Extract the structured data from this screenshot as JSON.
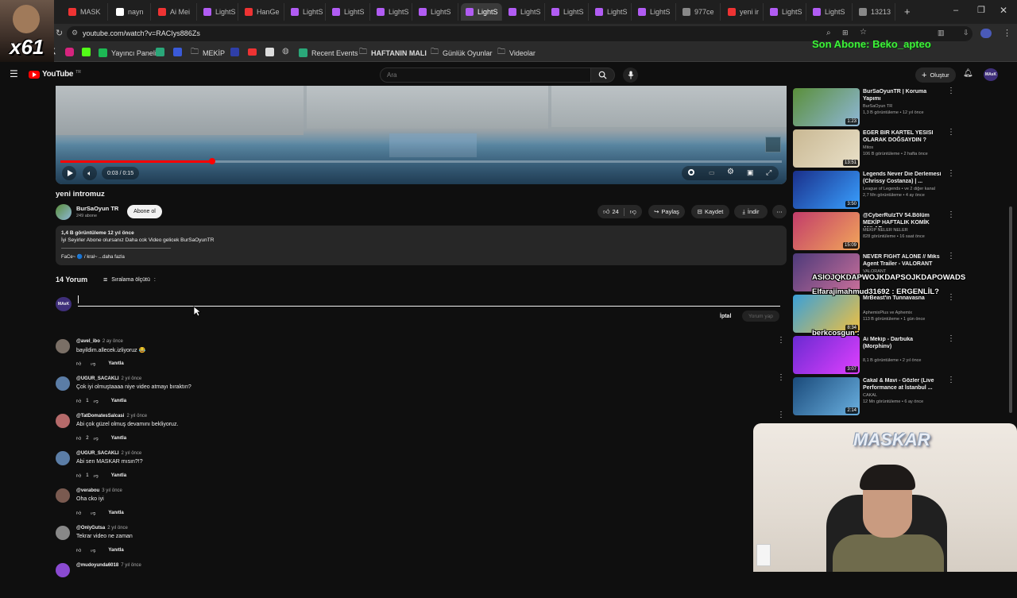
{
  "browser": {
    "tabs": [
      {
        "label": "MASK",
        "color": "#e33"
      },
      {
        "label": "nayn",
        "color": "#fff"
      },
      {
        "label": "Ai Mei",
        "color": "#e33"
      },
      {
        "label": "LightS",
        "color": "#b15cf3"
      },
      {
        "label": "HanGe",
        "color": "#e33"
      },
      {
        "label": "LightS",
        "color": "#b15cf3"
      },
      {
        "label": "LightS",
        "color": "#b15cf3"
      },
      {
        "label": "LightS",
        "color": "#b15cf3"
      },
      {
        "label": "LightS",
        "color": "#b15cf3"
      },
      {
        "label": "LightS",
        "color": "#b15cf3"
      },
      {
        "label": "LightS",
        "color": "#b15cf3"
      },
      {
        "label": "LightS",
        "color": "#b15cf3"
      },
      {
        "label": "LightS",
        "color": "#b15cf3"
      },
      {
        "label": "LightS",
        "color": "#b15cf3"
      },
      {
        "label": "977ce",
        "color": "#888"
      },
      {
        "label": "yeni ir",
        "color": "#e33"
      },
      {
        "label": "LightS",
        "color": "#b15cf3"
      },
      {
        "label": "LightS",
        "color": "#b15cf3"
      },
      {
        "label": "13213",
        "color": "#888"
      }
    ],
    "new_tab": "+",
    "url": "youtube.com/watch?v=RACIys886Zs",
    "bookmarks": [
      {
        "label": "Yayıncı Paneli",
        "color": "#1db954"
      },
      {
        "label": "MEKİP",
        "color": "#888"
      },
      {
        "label": "Recent Events",
        "color": "#2aa779"
      },
      {
        "label": "HAFTANIN MALI",
        "color": "#888"
      },
      {
        "label": "Günlük Oyunlar",
        "color": "#888"
      },
      {
        "label": "Videolar",
        "color": "#888"
      }
    ]
  },
  "overlay": {
    "x_badge": "x61",
    "son_abone": "Son Abone: Beko_apteo",
    "chat_line1": "ASIOJQKDAPWOJKDAPSOJKDAPOWADS",
    "chat_line2": "Elfarajimahmud31692 : ERGENLİL?",
    "chat_line3": "berkcosgun :",
    "webcam_name": "MASKAR"
  },
  "yt": {
    "logo": "YouTube",
    "logo_region": "TR",
    "search_placeholder": "Ara",
    "create_label": "Oluştur",
    "avatar_text": "MAsK"
  },
  "player": {
    "time": "0:03 / 0:15",
    "progress_fraction": 0.21
  },
  "video": {
    "title": "yeni intromuz",
    "channel": "BurSaOyun TR",
    "subs": "249 abone",
    "subscribe": "Abone ol",
    "likes": "24",
    "share": "Paylaş",
    "save": "Kaydet",
    "download": "İndir",
    "stats": "1,4 B görüntüleme  12 yıl önce",
    "desc": "İyi Seyirler Abone olursanız Daha cok Video gelicek BurSaOyunTR",
    "desc2": "FaCe~ 🔵 / kral~ ...daha fazla"
  },
  "comments_header": {
    "count": "14 Yorum",
    "sort": "Sıralama ölçütü",
    "cancel": "İptal",
    "submit": "Yorum yap"
  },
  "comments": [
    {
      "author": "@avel_ibo",
      "age": "2 ay önce",
      "text": "bayildim.allecek.izliyoruz 😂",
      "likes": "",
      "reply": "Yanıtla",
      "color": "#7a6f66"
    },
    {
      "author": "@UGUR_SACAKLI",
      "age": "2 yıl önce",
      "text": "Çok iyi olmuştaaaa niye video atmayı bıraktın?",
      "likes": "1",
      "reply": "Yanıtla",
      "color": "#5b7da6"
    },
    {
      "author": "@TatDomatesSalcasi",
      "age": "2 yıl önce",
      "text": "Abi çok güzel olmuş devamını bekliyoruz.",
      "likes": "2",
      "reply": "Yanıtla",
      "color": "#b56a6a"
    },
    {
      "author": "@UGUR_SACAKLI",
      "age": "2 yıl önce",
      "text": "Abi sen MASKAR mısın?!?",
      "likes": "1",
      "reply": "Yanıtla",
      "color": "#5b7da6"
    },
    {
      "author": "@verabou",
      "age": "3 yıl önce",
      "text": "Oha cko iyi",
      "likes": "",
      "reply": "Yanıtla",
      "color": "#7a5a50"
    },
    {
      "author": "@OnlyGutsa",
      "age": "2 yıl önce",
      "text": "Tekrar video ne zaman",
      "likes": "",
      "reply": "Yanıtla",
      "color": "#888888"
    },
    {
      "author": "@mudoyunda6018",
      "age": "7 yıl önce",
      "text": "",
      "likes": "",
      "reply": "",
      "color": "#8a4ad1"
    }
  ],
  "recommendations": [
    {
      "title": "BurSaOyunTR | Koruma Yapımı",
      "channel": "BurSaOyun TR",
      "meta": "1,3 B görüntüleme • 12 yıl önce",
      "duration": "1:23",
      "c1": "#5a8f3a",
      "c2": "#8fb7d8"
    },
    {
      "title": "EĞER BİR KARTEL YESİSİ OLARAK DOĞSAYDIN ?",
      "channel": "Mitos",
      "meta": "106 B görüntüleme • 2 hafta önce",
      "duration": "13:51",
      "c1": "#c9b893",
      "c2": "#e9e0c8"
    },
    {
      "title": "Legends Never Die Derlemesi (Chrissy Costanza) | ...",
      "channel": "League of Legends • ve 2 diğer kanal",
      "meta": "2,7 Mn görüntüleme • 4 ay önce",
      "duration": "3:50",
      "c1": "#1a2f8a",
      "c2": "#39a0ff"
    },
    {
      "title": "@CyberRulzTV 54.Bölüm MEKİP HAFTALIK KOMİK ANLAR ...",
      "channel": "MEKİP NELER NELER",
      "meta": "828 görüntüleme • 16 saat önce",
      "duration": "15:09",
      "c1": "#c23c6a",
      "c2": "#f2a65a"
    },
    {
      "title": "NEVER FIGHT ALONE // Miks Agent Trailer - VALORANT",
      "channel": "VALORANT",
      "meta": "",
      "duration": "",
      "c1": "#4d3a7a",
      "c2": "#c86f9a"
    },
    {
      "title": "MrBeast'in Tunnavasna",
      "channel": "AphemixPlus ve Aphemix",
      "meta": "113 B görüntüleme • 1 gün önce",
      "duration": "8:34",
      "c1": "#3aa0d8",
      "c2": "#f0c040"
    },
    {
      "title": "Ai Mekip - Darbuka (Morphinv)",
      "channel": "",
      "meta": "8,1 B görüntüleme • 2 yıl önce",
      "duration": "3:07",
      "c1": "#6a2ad1",
      "c2": "#e040ff"
    },
    {
      "title": "Cakal & Mavi - Gözler (Live Performance at İstanbul ...",
      "channel": "CAKAL",
      "meta": "12 Mn görüntüleme • 6 ay önce",
      "duration": "2:14",
      "c1": "#1a4a7a",
      "c2": "#6ab0e0"
    }
  ]
}
